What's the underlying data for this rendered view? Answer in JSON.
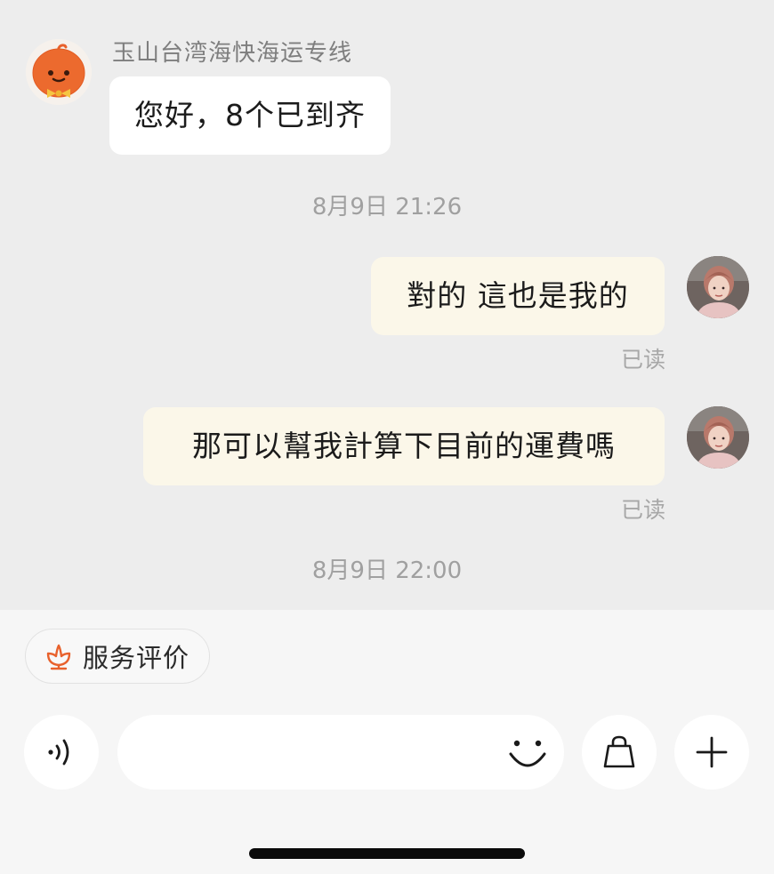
{
  "chat": {
    "shop_name": "玉山台湾海快海运专线",
    "messages": [
      {
        "direction": "incoming",
        "text": "您好，8个已到齐"
      },
      {
        "direction": "outgoing",
        "text": "對的 這也是我的",
        "status": "已读"
      },
      {
        "direction": "outgoing",
        "text": "那可以幫我計算下目前的運費嗎",
        "status": "已读"
      }
    ],
    "timestamps": [
      "8月9日 21:26",
      "8月9日 22:00"
    ]
  },
  "bottom_bar": {
    "rating_chip_label": "服务评价",
    "input_placeholder": "",
    "icons": [
      "voice-icon",
      "smiley-icon",
      "shopping-bag-icon",
      "plus-icon",
      "flower-icon"
    ]
  },
  "colors": {
    "background": "#ededed",
    "incoming_bubble": "#ffffff",
    "outgoing_bubble": "#fbf7e9",
    "accent_orange": "#e8612c"
  }
}
